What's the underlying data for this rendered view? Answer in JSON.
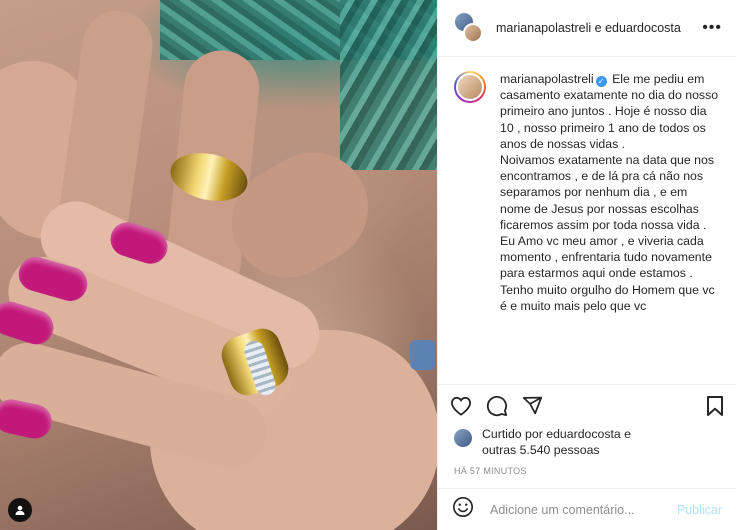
{
  "post": {
    "image_description_icon": "user-tag-icon"
  },
  "header": {
    "title": "marianapolastreli e eduardocosta",
    "more_icon": "more-options-icon"
  },
  "caption": {
    "username": "marianapolastreli",
    "verified_icon": "verified-badge-icon",
    "lines": [
      "Ele me pediu em casamento exatamente no dia do nosso primeiro ano juntos . Hoje é nosso dia 10 , nosso primeiro 1 ano de todos os anos de nossas vidas .",
      "Noivamos exatamente na data que nos encontramos , e de lá pra cá não nos separamos por nenhum dia , e em nome de Jesus por nossas escolhas ficaremos assim por toda nossa vida .",
      "Eu Amo vc meu amor , e viveria cada momento , enfrentaria tudo novamente para estarmos aqui onde estamos .",
      "Tenho muito orgulho do Homem que vc é e muito mais pelo que vc"
    ]
  },
  "actions": {
    "like_icon": "heart-icon",
    "comment_icon": "comment-icon",
    "share_icon": "share-icon",
    "save_icon": "bookmark-icon"
  },
  "likes": {
    "text_line1": "Curtido por eduardocosta e",
    "text_line2": "outras 5.540 pessoas"
  },
  "timestamp": "HÁ 57 MINUTOS",
  "comment_box": {
    "emoji_icon": "emoji-icon",
    "placeholder": "Adicione um comentário...",
    "value": "",
    "publish_label": "Publicar"
  },
  "colors": {
    "nail_polish": "#c2187a",
    "verified": "#3897f0",
    "publish_disabled": "#b2dffc"
  }
}
